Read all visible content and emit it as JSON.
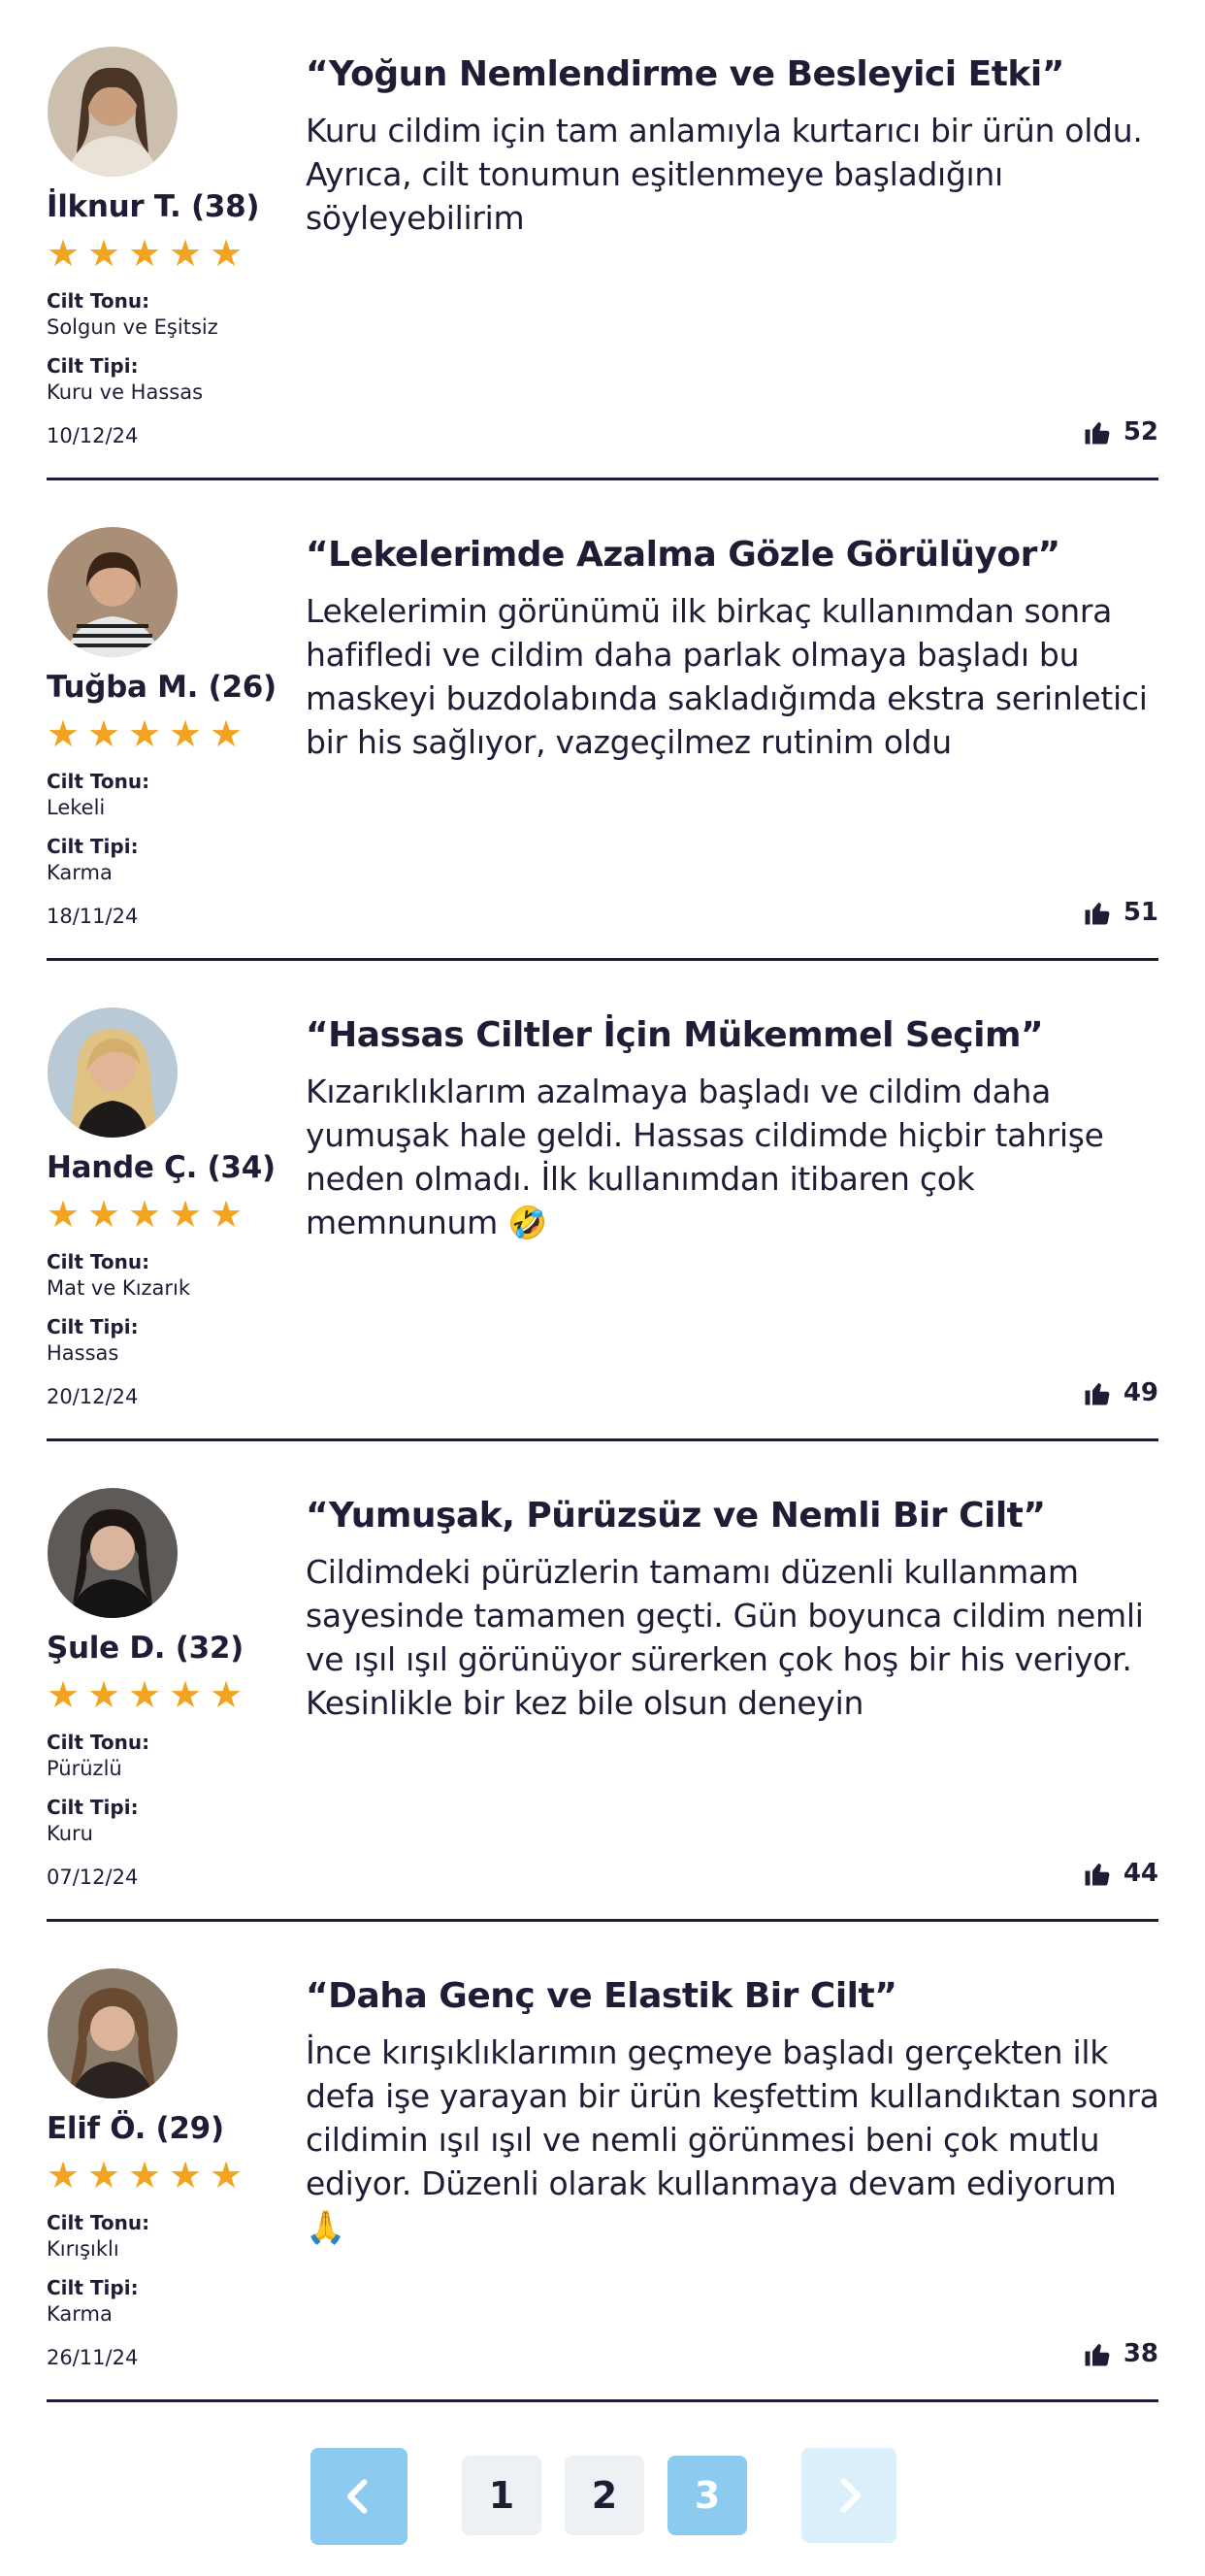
{
  "reviews": [
    {
      "name": "İlknur T. (38)",
      "rating_stars": 5,
      "skin_tone_label": "Cilt Tonu:",
      "skin_tone": "Solgun ve Eşitsiz",
      "skin_type_label": "Cilt Tipi:",
      "skin_type": "Kuru ve Hassas",
      "date": "10/12/24",
      "title": "“Yoğun Nemlendirme ve Besleyici Etki”",
      "body": "Kuru cildim için tam anlamıyla kurtarıcı bir ürün oldu. Ayrıca, cilt tonumun eşitlenmeye başladığını söyleyebilirim",
      "likes": "52"
    },
    {
      "name": "Tuğba M. (26)",
      "rating_stars": 5,
      "skin_tone_label": "Cilt Tonu:",
      "skin_tone": "Lekeli",
      "skin_type_label": "Cilt Tipi:",
      "skin_type": "Karma",
      "date": "18/11/24",
      "title": "“Lekelerimde Azalma Gözle Görülüyor”",
      "body": "Lekelerimin görünümü ilk birkaç kullanımdan sonra hafifledi ve cildim daha parlak olmaya başladı bu maskeyi buzdolabında sakladığımda ekstra serinletici bir his sağlıyor, vazgeçilmez rutinim oldu",
      "likes": "51"
    },
    {
      "name": "Hande Ç. (34)",
      "rating_stars": 5,
      "skin_tone_label": "Cilt Tonu:",
      "skin_tone": "Mat ve Kızarık",
      "skin_type_label": "Cilt Tipi:",
      "skin_type": "Hassas",
      "date": "20/12/24",
      "title": "“Hassas Ciltler İçin Mükemmel Seçim”",
      "body": "Kızarıklıklarım azalmaya başladı ve cildim daha yumuşak hale geldi. Hassas cildimde hiçbir tahrişe neden olmadı. İlk kullanımdan itibaren çok memnunum 🤣",
      "likes": "49"
    },
    {
      "name": "Şule D. (32)",
      "rating_stars": 5,
      "skin_tone_label": "Cilt Tonu:",
      "skin_tone": "Pürüzlü",
      "skin_type_label": "Cilt Tipi:",
      "skin_type": "Kuru",
      "date": "07/12/24",
      "title": "“Yumuşak, Pürüzsüz ve Nemli Bir Cilt”",
      "body": "Cildimdeki pürüzlerin tamamı düzenli kullanmam sayesinde tamamen geçti. Gün boyunca cildim nemli ve ışıl ışıl görünüyor sürerken çok hoş bir his veriyor. Kesinlikle bir kez bile olsun deneyin",
      "likes": "44"
    },
    {
      "name": "Elif Ö. (29)",
      "rating_stars": 5,
      "skin_tone_label": "Cilt Tonu:",
      "skin_tone": "Kırışıklı",
      "skin_type_label": "Cilt Tipi:",
      "skin_type": "Karma",
      "date": "26/11/24",
      "title": "“Daha Genç ve Elastik Bir Cilt”",
      "body": "İnce kırışıklıklarımın geçmeye başladı gerçekten ilk defa işe yarayan bir ürün keşfettim kullandıktan sonra cildimin ışıl ışıl ve nemli görünmesi beni çok mutlu ediyor. Düzenli olarak kullanmaya devam ediyorum 🙏",
      "likes": "38"
    }
  ],
  "pagination": {
    "pages": [
      "1",
      "2",
      "3"
    ],
    "current": "3"
  },
  "colors": {
    "star": "#f2a320",
    "text": "#1f1d36",
    "page_active": "#8ccaf0",
    "page_inactive": "#eef1f4",
    "next_disabled": "#dcf0fb"
  },
  "icons": {
    "rating": "star-icon",
    "likes": "thumbs-up-icon",
    "prev": "chevron-left-icon",
    "next": "chevron-right-icon"
  }
}
